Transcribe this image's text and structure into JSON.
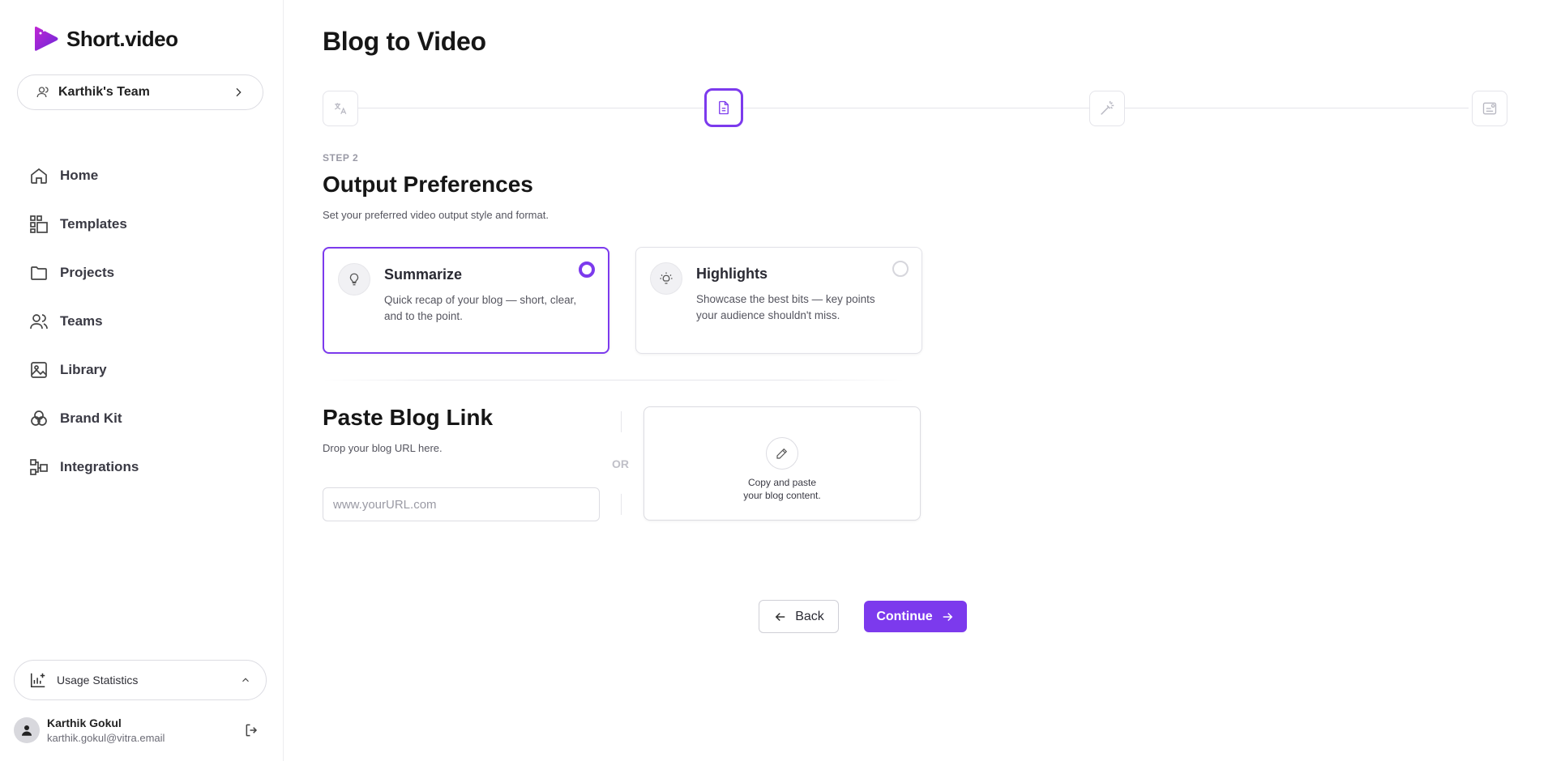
{
  "app": {
    "logo_text": "Short.video",
    "brand_color": "#7c3aed"
  },
  "sidebar": {
    "team_name": "Karthik's Team",
    "items": [
      {
        "label": "Home",
        "icon": "home-icon"
      },
      {
        "label": "Templates",
        "icon": "templates-icon"
      },
      {
        "label": "Projects",
        "icon": "folder-icon"
      },
      {
        "label": "Teams",
        "icon": "users-icon"
      },
      {
        "label": "Library",
        "icon": "image-icon"
      },
      {
        "label": "Brand Kit",
        "icon": "brand-kit-icon"
      },
      {
        "label": "Integrations",
        "icon": "integrations-icon"
      }
    ],
    "usage_label": "Usage Statistics",
    "user": {
      "name": "Karthik Gokul",
      "email": "karthik.gokul@vitra.email"
    }
  },
  "main": {
    "title": "Blog to Video",
    "stepper": {
      "steps": [
        {
          "icon": "translate-icon",
          "state": "inactive"
        },
        {
          "icon": "document-icon",
          "state": "active"
        },
        {
          "icon": "magic-wand-icon",
          "state": "inactive"
        },
        {
          "icon": "finalize-icon",
          "state": "inactive"
        }
      ]
    },
    "step_kicker": "STEP 2",
    "section_title": "Output Preferences",
    "section_subtitle": "Set your preferred video output style and format.",
    "options": [
      {
        "title": "Summarize",
        "description": "Quick recap of your blog — short, clear, and to the point.",
        "icon": "lightbulb-icon",
        "selected": true
      },
      {
        "title": "Highlights",
        "description": "Showcase the best bits — key points your audience shouldn't miss.",
        "icon": "idea-spark-icon",
        "selected": false
      }
    ],
    "paste": {
      "title": "Paste Blog Link",
      "subtitle": "Drop your blog URL here.",
      "url_placeholder": "www.yourURL.com",
      "url_value": "",
      "or_label": "OR",
      "box_line1": "Copy and paste",
      "box_line2": "your blog content."
    },
    "buttons": {
      "back": "Back",
      "continue": "Continue"
    }
  }
}
